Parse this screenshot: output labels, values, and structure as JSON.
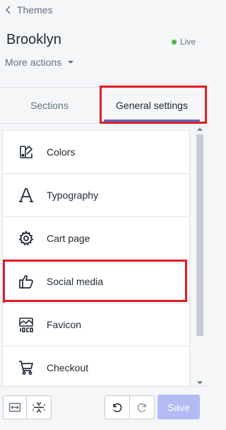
{
  "header": {
    "back_label": "Themes",
    "theme_name": "Brooklyn",
    "status": "Live",
    "more_actions": "More actions"
  },
  "tabs": [
    {
      "label": "Sections"
    },
    {
      "label": "General settings"
    }
  ],
  "settings": {
    "items": [
      {
        "label": "Colors",
        "icon": "colors-icon"
      },
      {
        "label": "Typography",
        "icon": "typography-icon"
      },
      {
        "label": "Cart page",
        "icon": "gear-icon"
      },
      {
        "label": "Social media",
        "icon": "thumbs-up-icon"
      },
      {
        "label": "Favicon",
        "icon": "favicon-icon"
      },
      {
        "label": "Checkout",
        "icon": "cart-icon"
      }
    ]
  },
  "footer": {
    "save_label": "Save"
  },
  "colors": {
    "accent": "#5c6ac4",
    "live_dot": "#50b83c",
    "highlight": "#e21b23",
    "save_disabled": "#b3bcf5"
  }
}
